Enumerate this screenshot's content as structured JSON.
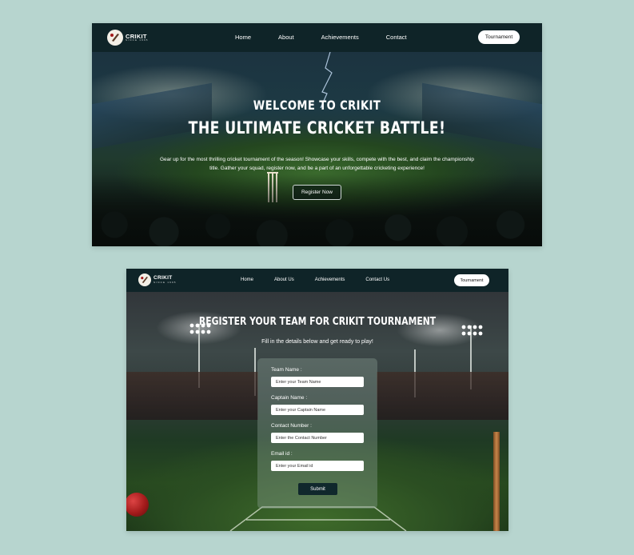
{
  "brand": {
    "name": "CRIKIT",
    "tagline": "SINCE 1995"
  },
  "colors": {
    "background": "#b7d5cf",
    "nav": "#0f2428",
    "accent_button": "#10282c"
  },
  "hero_page": {
    "nav": {
      "home": "Home",
      "about": "About",
      "achievements": "Achievements",
      "contact": "Contact",
      "cta": "Tournament"
    },
    "title_line1": "WELCOME TO CRIKIT",
    "title_line2": "THE ULTIMATE CRICKET BATTLE!",
    "description": "Gear up for the most thrilling cricket tournament of the season! Showcase your skills, compete with the best, and claim the championship title. Gather your squad, register now, and be a part of an unforgettable cricketing experience!",
    "register_button": "Register Now"
  },
  "register_page": {
    "nav": {
      "home": "Home",
      "about": "About Us",
      "achievements": "Achievements",
      "contact": "Contact Us",
      "cta": "Tournament"
    },
    "title": "REGISTER YOUR TEAM FOR CRIKIT TOURNAMENT",
    "subtitle": "Fill in the details below and get ready to play!",
    "form": {
      "team_label": "Team Name :",
      "team_placeholder": "Enter your Team Name",
      "captain_label": "Captain Name :",
      "captain_placeholder": "Enter your Captain Name",
      "contact_label": "Contact Number :",
      "contact_placeholder": "Enter the Contact Number",
      "email_label": "Email id :",
      "email_placeholder": "Enter your Email id",
      "submit": "Submit"
    }
  }
}
